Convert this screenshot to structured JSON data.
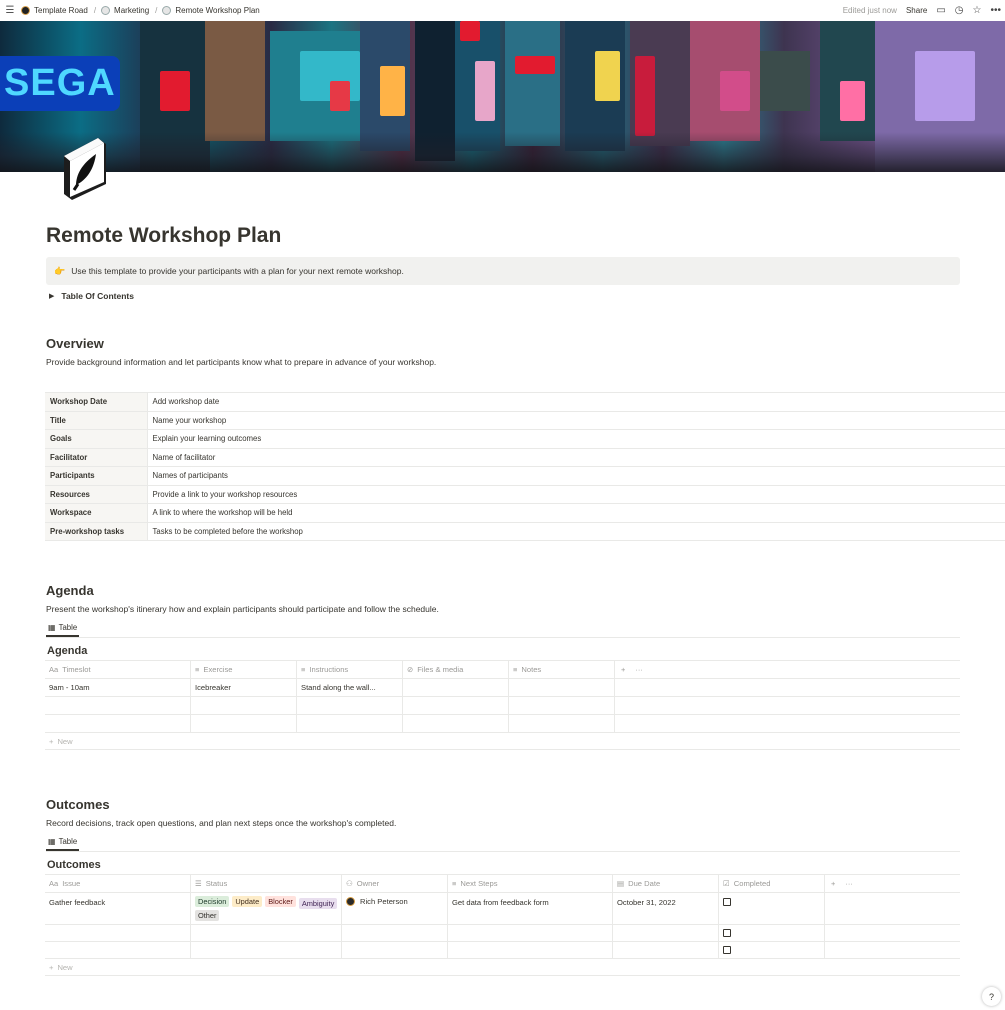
{
  "topbar": {
    "breadcrumbs": [
      "Template Road",
      "Marketing",
      "Remote Workshop Plan"
    ],
    "edited": "Edited just now",
    "share": "Share",
    "icons": [
      "comment-icon",
      "clock-icon",
      "star-icon",
      "more-icon"
    ]
  },
  "cover": {
    "sign_text": "SEGA"
  },
  "page": {
    "title": "Remote Workshop Plan",
    "callout_icon": "👉",
    "callout": "Use this template to provide your participants with a plan for your next remote workshop.",
    "toggle": "Table Of Contents"
  },
  "overview": {
    "heading": "Overview",
    "description": "Provide background information and let participants know what to prepare in advance of your workshop.",
    "rows": [
      {
        "key": "Workshop Date",
        "value": "Add workshop date"
      },
      {
        "key": "Title",
        "value": "Name your workshop"
      },
      {
        "key": "Goals",
        "value": "Explain your learning outcomes"
      },
      {
        "key": "Facilitator",
        "value": "Name of facilitator"
      },
      {
        "key": "Participants",
        "value": "Names of participants"
      },
      {
        "key": "Resources",
        "value": "Provide a link to your workshop resources"
      },
      {
        "key": "Workspace",
        "value": "A link to where the workshop will be held"
      },
      {
        "key": "Pre-workshop tasks",
        "value": "Tasks to be completed before the workshop"
      }
    ]
  },
  "agenda": {
    "heading": "Agenda",
    "description": "Present the workshop's itinerary how and explain participants should participate and follow the schedule.",
    "tab": "Table",
    "db_title": "Agenda",
    "columns": [
      "Timeslot",
      "Exercise",
      "Instructions",
      "Files & media",
      "Notes"
    ],
    "rows": [
      [
        "9am - 10am",
        "Icebreaker",
        "Stand along the wall...",
        "",
        ""
      ],
      [
        "",
        "",
        "",
        "",
        ""
      ],
      [
        "",
        "",
        "",
        "",
        ""
      ]
    ],
    "new_label": "New"
  },
  "outcomes": {
    "heading": "Outcomes",
    "description": "Record decisions, track open questions, and plan next steps once the workshop's completed.",
    "tab": "Table",
    "db_title": "Outcomes",
    "columns": [
      "Issue",
      "Status",
      "Owner",
      "Next Steps",
      "Due Date",
      "Completed"
    ],
    "row1": {
      "issue": "Gather feedback",
      "tags": [
        "Decision",
        "Update",
        "Blocker",
        "Ambiguity",
        "Other"
      ],
      "owner": "Rich Peterson",
      "next_steps": "Get data from feedback form",
      "due": "October 31, 2022"
    },
    "new_label": "New"
  },
  "help": "?"
}
